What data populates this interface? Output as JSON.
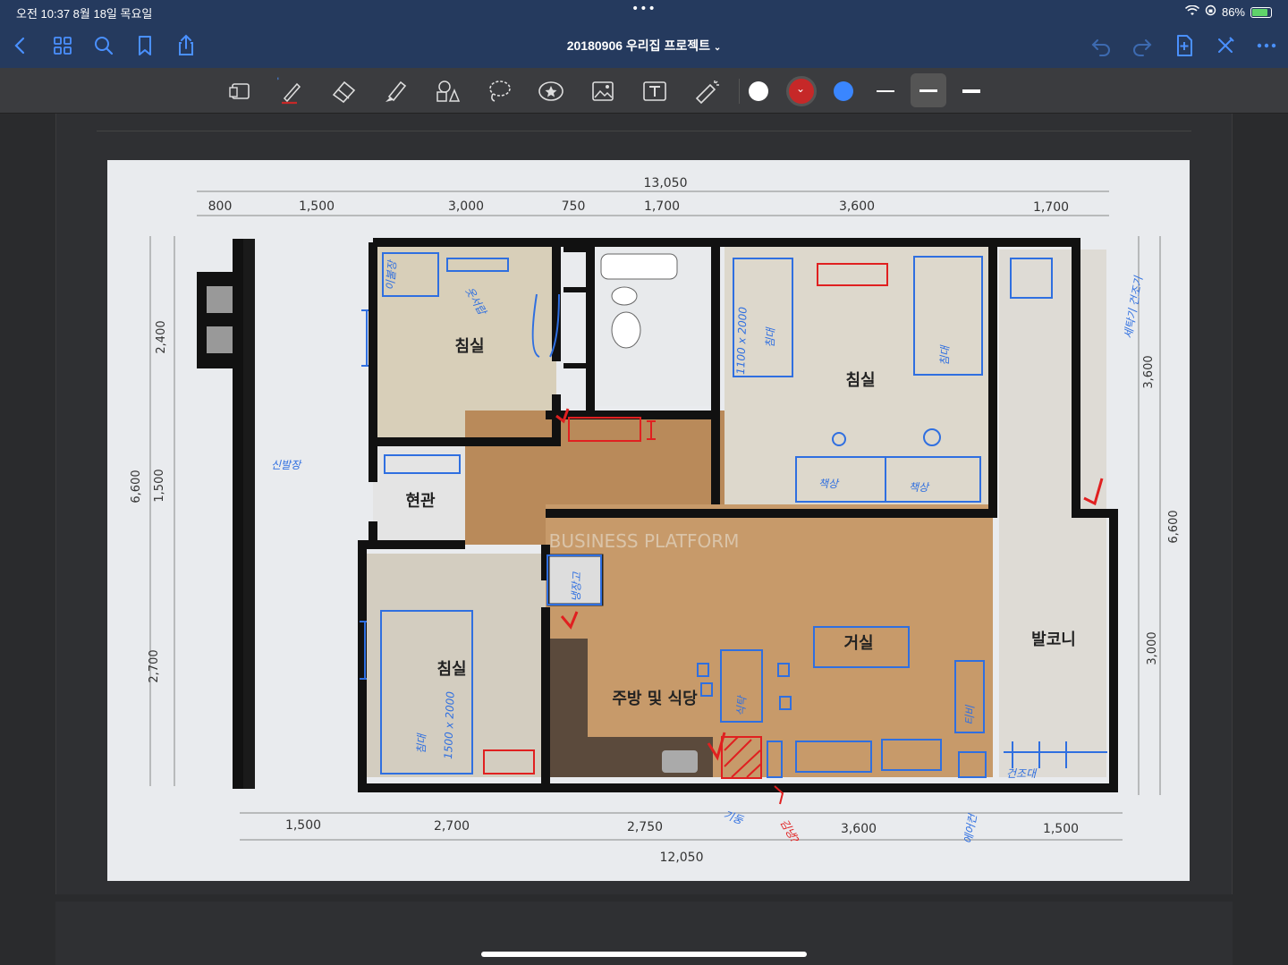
{
  "status_bar": {
    "time_date": "오전 10:37   8월 18일 목요일",
    "battery": "86%",
    "battery_level": 0.86
  },
  "nav": {
    "title": "20180906 우리집 프로젝트"
  },
  "toolbar": {
    "tools": [
      "document-scan-icon",
      "pen-icon",
      "eraser-icon",
      "highlighter-icon",
      "shapes-icon",
      "lasso-icon",
      "sticker-icon",
      "image-icon",
      "text-icon",
      "laser-pointer-icon"
    ],
    "colors": [
      "#ffffff",
      "#c62828",
      "#3a86ff"
    ],
    "selected_color": "#c62828"
  },
  "floorplan": {
    "top_total": "13,050",
    "top_dims": [
      "800",
      "1,500",
      "3,000",
      "750",
      "1,700",
      "3,600",
      "1,700"
    ],
    "bottom_total": "12,050",
    "bottom_dims": [
      "1,500",
      "2,700",
      "2,750",
      "3,600",
      "1,500"
    ],
    "left_total": "6,600",
    "left_dims": [
      "2,400",
      "1,500",
      "2,700"
    ],
    "right_total": "6,600",
    "right_dims": [
      "3,600",
      "3,000"
    ],
    "rooms": {
      "bedroom_1": "침실",
      "bedroom_2": "침실",
      "bedroom_3": "침실",
      "entrance": "현관",
      "living": "거실",
      "kitchen": "주방 및 식당",
      "balcony": "발코니"
    },
    "watermark": "BUSINESS PLATFORM",
    "annotations": {
      "shoe_cabinet": "신발장",
      "bed_size_1": "1100 x 2000",
      "bed_1": "침대",
      "bed_2": "침대",
      "bed_size_2": "1500 x 2000",
      "bed_3": "침대",
      "desk": "책상",
      "fridge": "냉장고",
      "washer": "세탁기 건조기",
      "dining_table": "식탁",
      "tv": "티비",
      "column": "기둥",
      "fridge2": "김냉?",
      "aircon": "에어컨",
      "closet": "이불장",
      "drawer": "옷서랍",
      "hanger": "건조대",
      "desk2": "책상"
    }
  }
}
